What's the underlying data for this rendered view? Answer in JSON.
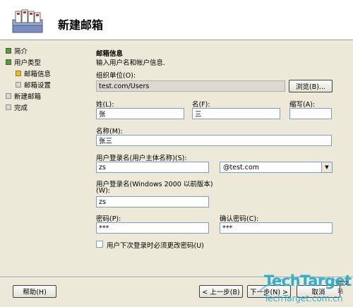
{
  "header": {
    "title": "新建邮箱"
  },
  "nav": {
    "items": [
      {
        "label": "简介",
        "state": "done"
      },
      {
        "label": "用户类型",
        "state": "done"
      },
      {
        "label": "邮箱信息",
        "state": "current"
      },
      {
        "label": "邮箱设置",
        "state": "current"
      },
      {
        "label": "新建邮箱",
        "state": "pending"
      },
      {
        "label": "完成",
        "state": "pending"
      }
    ]
  },
  "form": {
    "section_title": "邮箱信息",
    "section_desc": "输入用户名和帐户信息.",
    "org_unit": {
      "label": "组织单位(O):",
      "value": "test.com/Users"
    },
    "browse_label": "浏览(B)...",
    "last_name": {
      "label": "姓(L):",
      "value": "张"
    },
    "first_name": {
      "label": "名(F):",
      "value": "三"
    },
    "initials": {
      "label": "缩写(A):",
      "value": ""
    },
    "name": {
      "label": "名称(M):",
      "value": "张三"
    },
    "upn": {
      "label": "用户登录名(用户主体名称)(S):",
      "value": "zs"
    },
    "domain": {
      "value": "@test.com"
    },
    "pre2000": {
      "label": "用户登录名(Windows 2000 以前版本)",
      "label2": "(W):",
      "value": "zs"
    },
    "password": {
      "label": "密码(P):",
      "value": "***"
    },
    "confirm_password": {
      "label": "确认密码(C):",
      "value": "***"
    },
    "must_change": {
      "label": "用户下次登录时必须更改密码(U)",
      "checked": false
    }
  },
  "footer": {
    "help": "帮助(H)",
    "back": "< 上一步(B)",
    "next": "下一步(N) >",
    "cancel": "取消"
  },
  "watermark": {
    "brand": "TechTarget",
    "sub": "中文站",
    "url": "TechTarget.com.cn"
  }
}
